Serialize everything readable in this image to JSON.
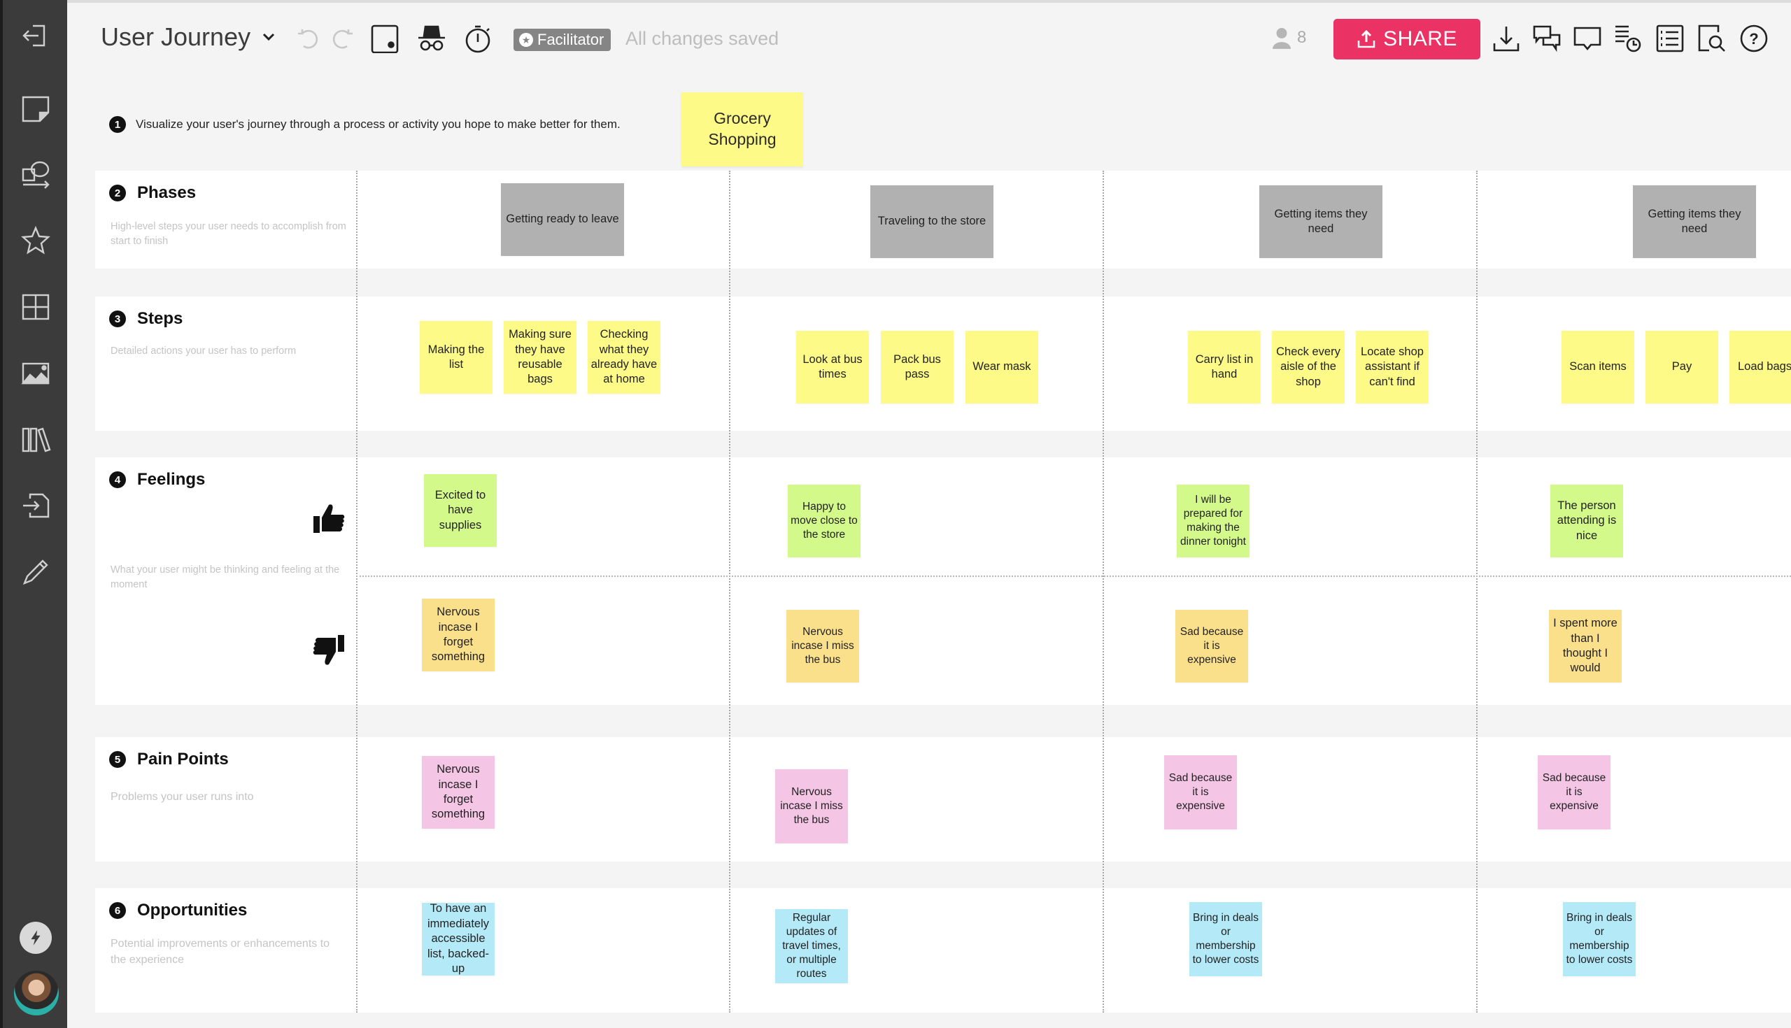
{
  "header": {
    "title": "User Journey",
    "facilitator_label": "Facilitator",
    "save_status": "All changes saved",
    "user_count": "8",
    "share_label": "SHARE",
    "icons": [
      "undo-icon",
      "redo-icon",
      "card-dot-icon",
      "incognito-icon",
      "timer-icon",
      "download-icon",
      "comments-icon",
      "chat-icon",
      "activity-history-icon",
      "outline-list-icon",
      "search-board-icon",
      "help-icon"
    ]
  },
  "sidebar": {
    "items": [
      "exit-board",
      "sticky-note",
      "shapes-and-lines",
      "favorites",
      "templates",
      "images",
      "library",
      "import",
      "pen"
    ],
    "footer": [
      "quick-actions",
      "user-avatar"
    ]
  },
  "board": {
    "intro_number": "1",
    "intro_text": "Visualize your user's journey through a process or activity you hope to make better for them.",
    "journey_title": "Grocery Shopping",
    "colors": {
      "phase": "#b1b1b1",
      "step": "#fdfa87",
      "feeling_positive": "#d4f98b",
      "feeling_negative": "#fbe08c",
      "pain_point": "#f5c5e6",
      "opportunity": "#b4eaf8",
      "share": "#ea3264"
    },
    "rows": {
      "phases": {
        "number": "2",
        "title": "Phases",
        "description": "High-level steps your user needs to accomplish from start to finish"
      },
      "steps": {
        "number": "3",
        "title": "Steps",
        "description": "Detailed actions your user has to perform"
      },
      "feelings": {
        "number": "4",
        "title": "Feelings",
        "description": "What your user might be thinking and feeling at the moment"
      },
      "pain_points": {
        "number": "5",
        "title": "Pain Points",
        "description": "Problems your user runs into"
      },
      "opportunities": {
        "number": "6",
        "title": "Opportunities",
        "description": "Potential improvements or enhancements to the experience"
      }
    },
    "columns": [
      {
        "phase": "Getting ready to leave",
        "steps": [
          "Making the list",
          "Making sure they have reusable bags",
          "Checking what they already have at home"
        ],
        "feeling_positive": "Excited to have supplies",
        "feeling_negative": "Nervous incase I forget something",
        "pain_point": "Nervous incase I forget something",
        "opportunity": "To have an immediately accessible list, backed-up"
      },
      {
        "phase": "Traveling to the store",
        "steps": [
          "Look at bus times",
          "Pack bus pass",
          "Wear mask"
        ],
        "feeling_positive": "Happy to move close to the store",
        "feeling_negative": "Nervous incase I miss the bus",
        "pain_point": "Nervous incase I miss the bus",
        "opportunity": "Regular updates of travel times, or multiple routes"
      },
      {
        "phase": "Getting items they need",
        "steps": [
          "Carry list in hand",
          "Check every aisle of the shop",
          "Locate shop assistant if can't find"
        ],
        "feeling_positive": "I will be prepared for making the dinner tonight",
        "feeling_negative": "Sad because it is expensive",
        "pain_point": "Sad because it is expensive",
        "opportunity": "Bring in deals or membership to lower costs"
      },
      {
        "phase": "Getting items they need",
        "steps": [
          "Scan items",
          "Pay",
          "Load bags"
        ],
        "feeling_positive": "The person attending is nice",
        "feeling_negative": "I spent more than I thought I would",
        "pain_point": "Sad because it is expensive",
        "opportunity": "Bring in deals or membership to lower costs"
      }
    ]
  }
}
